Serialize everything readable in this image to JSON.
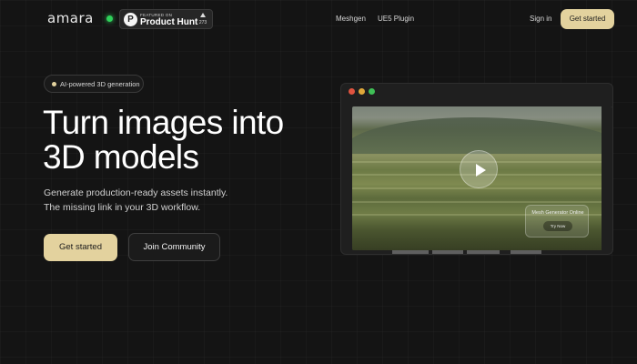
{
  "nav": {
    "logo": "amara",
    "product_hunt": {
      "featured": "FEATURED ON",
      "name": "Product Hunt",
      "votes": "273"
    },
    "links": [
      "Meshgen",
      "UE5 Plugin"
    ],
    "sign_in": "Sign in",
    "cta": "Get started"
  },
  "hero": {
    "tag": "AI-powered 3D generation",
    "title_line1": "Turn images into",
    "title_line2": "3D models",
    "subtitle_line1": "Generate production-ready assets instantly.",
    "subtitle_line2": "The missing link in your 3D workflow.",
    "primary_button": "Get started",
    "secondary_button": "Join Community"
  },
  "video": {
    "overlay_title": "Mesh Generator Online",
    "overlay_button": "Try Now"
  },
  "colors": {
    "background": "#141414",
    "accent": "#e3d29e",
    "live_indicator": "#2fd15a",
    "window_dots": [
      "#e0533f",
      "#e0a83a",
      "#3fbf56"
    ]
  },
  "icons": [
    "product-hunt-icon",
    "upvote-arrow-icon",
    "play-icon"
  ]
}
